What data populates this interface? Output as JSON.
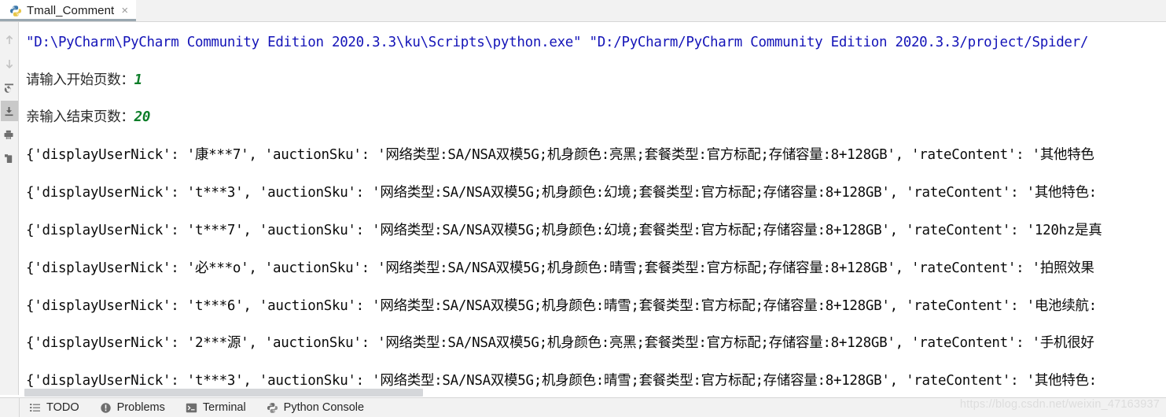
{
  "tab": {
    "label": "Tmall_Comment",
    "icon": "python-file-icon",
    "close_label": "×"
  },
  "left_toolbar": {
    "items": [
      {
        "name": "up-arrow-icon",
        "tooltip": "Up the Stack Trace",
        "selected": false
      },
      {
        "name": "down-arrow-icon",
        "tooltip": "Down the Stack Trace",
        "selected": false
      },
      {
        "name": "rerun-icon",
        "tooltip": "Rerun",
        "selected": false
      },
      {
        "name": "scroll-to-end-icon",
        "tooltip": "Scroll to the end",
        "selected": true
      },
      {
        "name": "print-icon",
        "tooltip": "Print",
        "selected": false
      },
      {
        "name": "clear-all-icon",
        "tooltip": "Clear All",
        "selected": false
      }
    ]
  },
  "console": {
    "lines": [
      {
        "type": "command",
        "text": "\"D:\\PyCharm\\PyCharm Community Edition 2020.3.3\\ku\\Scripts\\python.exe\" \"D:/PyCharm/PyCharm Community Edition 2020.3.3/project/Spider/"
      },
      {
        "type": "prompt",
        "prompt": "请输入开始页数：",
        "input": "1"
      },
      {
        "type": "prompt",
        "prompt": "亲输入结束页数：",
        "input": "20"
      },
      {
        "type": "dict",
        "text": "{'displayUserNick': '康***7', 'auctionSku': '网络类型:SA/NSA双模5G;机身颜色:亮黑;套餐类型:官方标配;存储容量:8+128GB', 'rateContent': '其他特色"
      },
      {
        "type": "dict",
        "text": "{'displayUserNick': 't***3', 'auctionSku': '网络类型:SA/NSA双模5G;机身颜色:幻境;套餐类型:官方标配;存储容量:8+128GB', 'rateContent': '其他特色:"
      },
      {
        "type": "dict",
        "text": "{'displayUserNick': 't***7', 'auctionSku': '网络类型:SA/NSA双模5G;机身颜色:幻境;套餐类型:官方标配;存储容量:8+128GB', 'rateContent': '120hz是真"
      },
      {
        "type": "dict",
        "text": "{'displayUserNick': '必***o', 'auctionSku': '网络类型:SA/NSA双模5G;机身颜色:晴雪;套餐类型:官方标配;存储容量:8+128GB', 'rateContent': '拍照效果"
      },
      {
        "type": "dict",
        "text": "{'displayUserNick': 't***6', 'auctionSku': '网络类型:SA/NSA双模5G;机身颜色:晴雪;套餐类型:官方标配;存储容量:8+128GB', 'rateContent': '电池续航:"
      },
      {
        "type": "dict",
        "text": "{'displayUserNick': '2***源', 'auctionSku': '网络类型:SA/NSA双模5G;机身颜色:亮黑;套餐类型:官方标配;存储容量:8+128GB', 'rateContent': '手机很好"
      },
      {
        "type": "dict",
        "text": "{'displayUserNick': 't***3', 'auctionSku': '网络类型:SA/NSA双模5G;机身颜色:晴雪;套餐类型:官方标配;存储容量:8+128GB', 'rateContent': '其他特色:"
      }
    ]
  },
  "status_bar": {
    "items": [
      {
        "label": "TODO",
        "icon": "todo-list-icon"
      },
      {
        "label": "Problems",
        "icon": "problems-warning-icon"
      },
      {
        "label": "Terminal",
        "icon": "terminal-icon"
      },
      {
        "label": "Python Console",
        "icon": "python-console-icon"
      }
    ]
  },
  "watermark": {
    "text": "https://blog.csdn.net/weixin_47163937"
  },
  "colors": {
    "command_text": "#1414b8",
    "input_value": "#0b7d28",
    "dict_text": "#0b0b0b",
    "chrome_bg": "#f2f2f2",
    "selected_toolbar_btn": "#c9c9c9"
  }
}
